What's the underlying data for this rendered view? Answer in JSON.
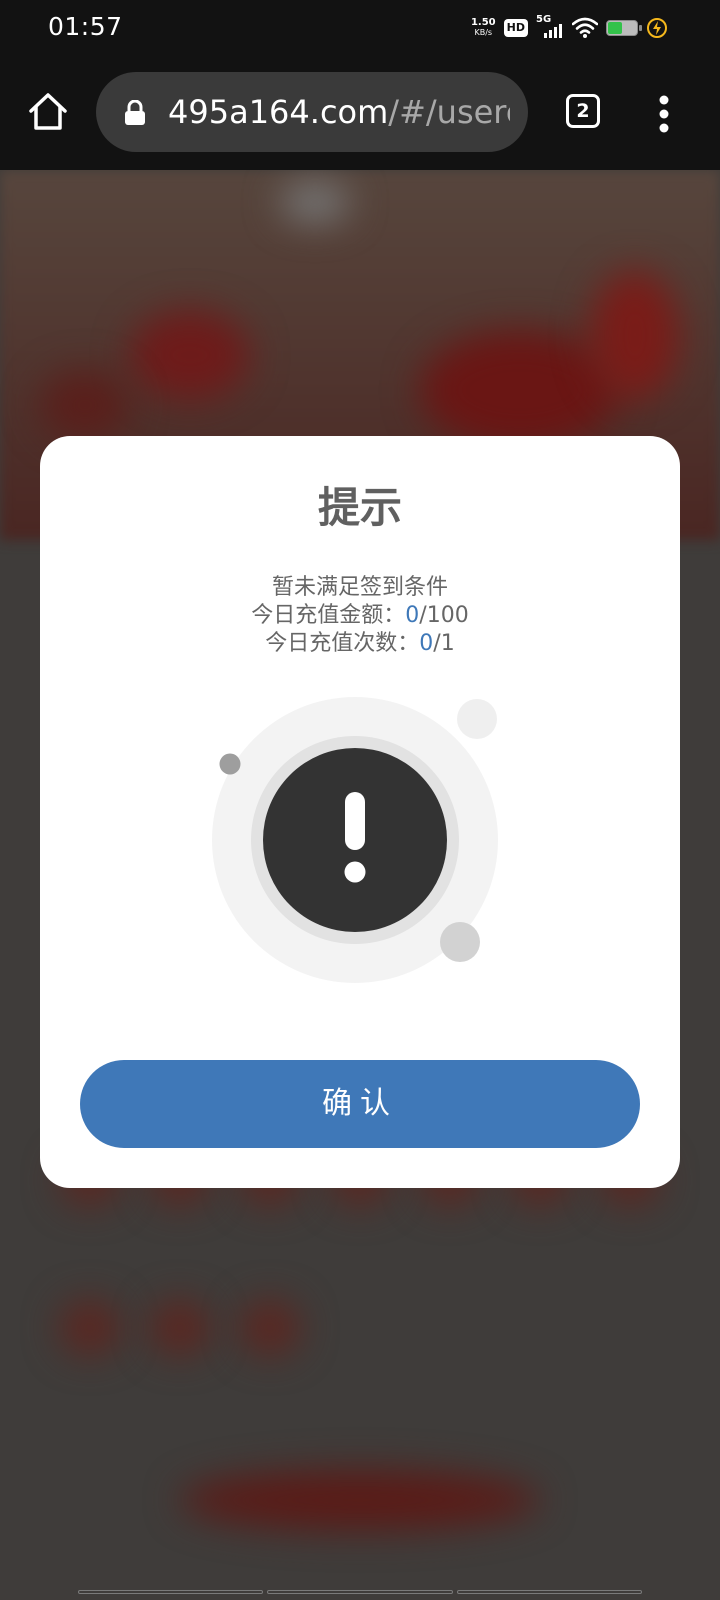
{
  "status_bar": {
    "time": "01:57",
    "net_speed_value": "1.50",
    "net_speed_unit": "KB/s",
    "hd_label": "HD",
    "network_label": "5G",
    "battery_level": 0.45,
    "battery_color": "#33c24a",
    "charging_icon_color": "#f5b81c"
  },
  "browser": {
    "url_domain": "495a164.com",
    "url_path": "/#/userce",
    "tab_count": "2",
    "icons": [
      "home-icon",
      "lock-icon",
      "tabs-icon",
      "more-vert-icon"
    ]
  },
  "dialog": {
    "title": "提示",
    "message_line1": "暂未满足签到条件",
    "recharge_amount_label": "今日充值金额：",
    "recharge_amount_current": "0",
    "recharge_amount_required": "/100",
    "recharge_count_label": "今日充值次数：",
    "recharge_count_current": "0",
    "recharge_count_required": "/1",
    "icon": "exclamation-icon",
    "confirm_label": "确认",
    "accent_color": "#3f78b8"
  }
}
